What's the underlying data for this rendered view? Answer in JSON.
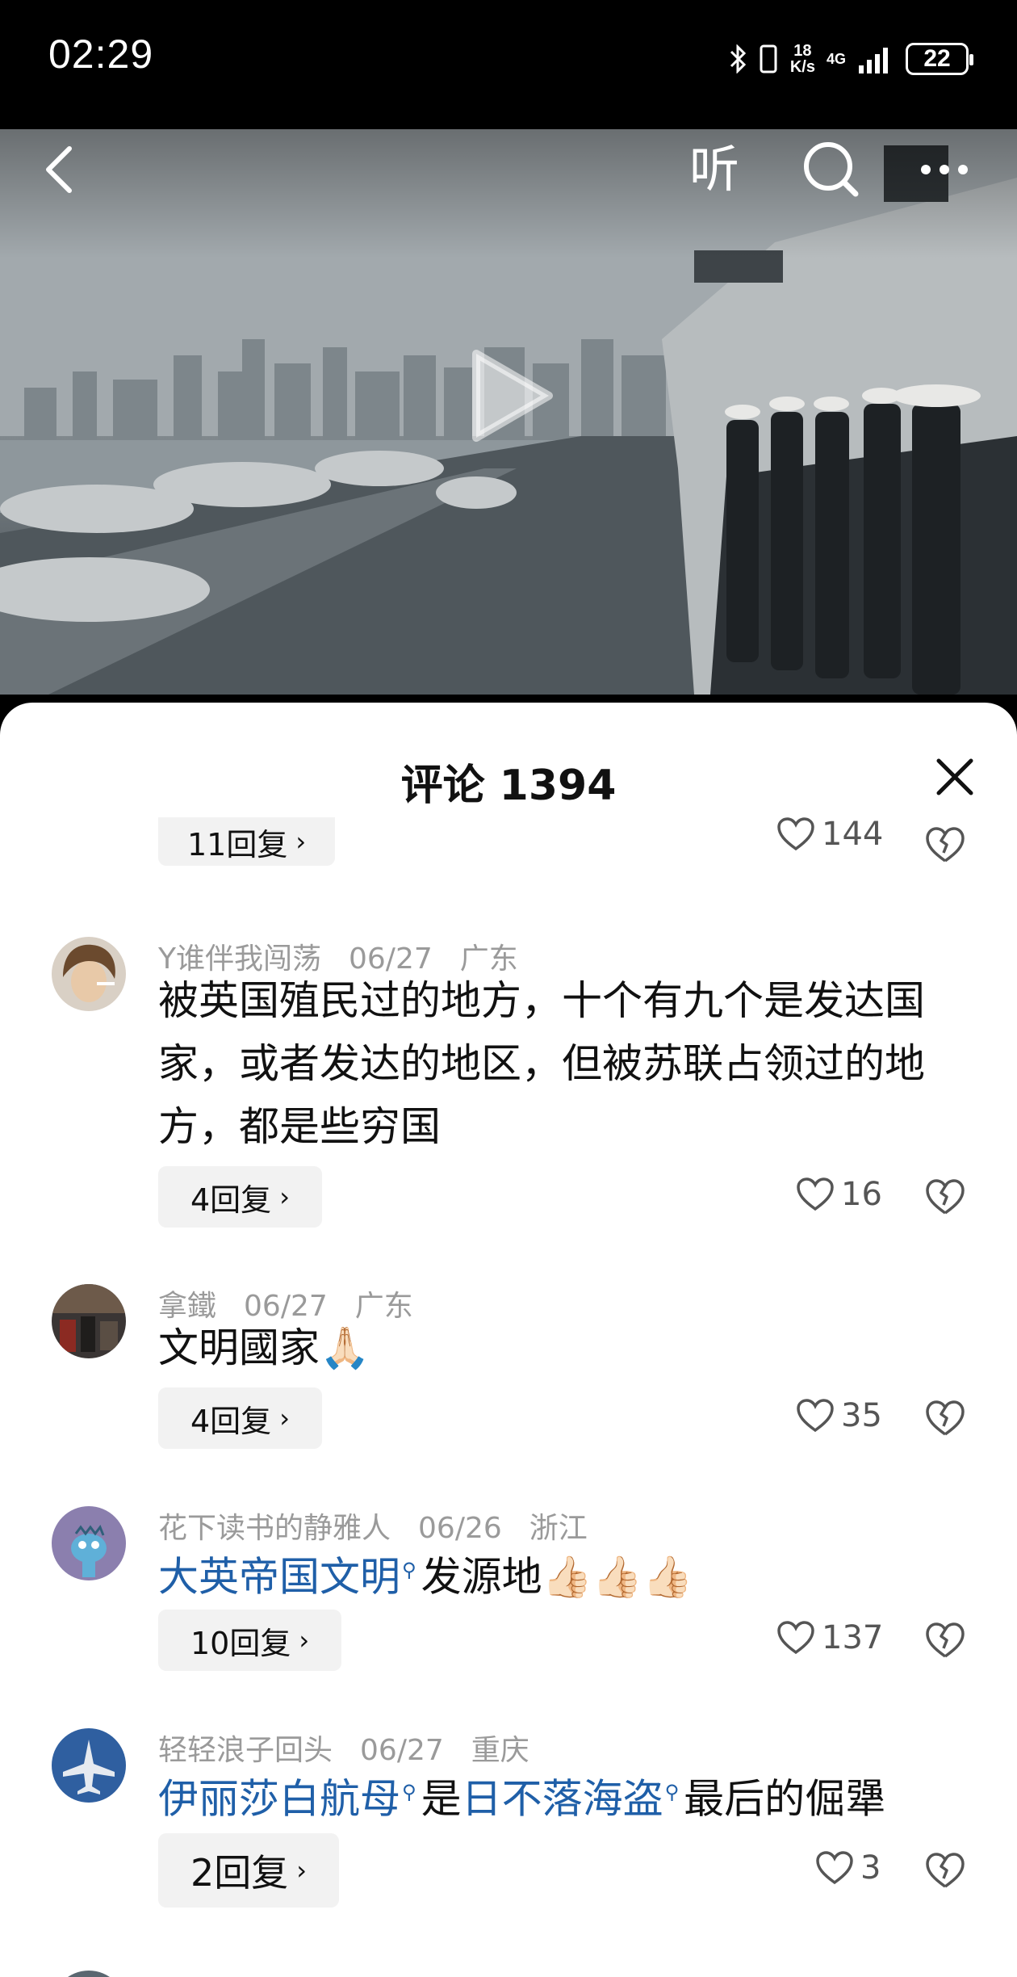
{
  "status_bar": {
    "time": "02:29",
    "net_speed_value": "18",
    "net_speed_unit": "K/s",
    "network": "4G",
    "battery": "22"
  },
  "video": {
    "listen_label": "听"
  },
  "comments_panel": {
    "title": "评论 1394",
    "partial_item": {
      "replies_label": "11回复",
      "likes": "144"
    },
    "items": [
      {
        "user": "Y谁伴我闯荡",
        "date": "06/27",
        "region": "广东",
        "text": "被英国殖民过的地方，十个有九个是发达国家，或者发达的地区，但被苏联占领过的地方，都是些穷国",
        "replies_label": "4回复",
        "likes": "16"
      },
      {
        "user": "拿鐵",
        "date": "06/27",
        "region": "广东",
        "text": "文明國家🙏🏻",
        "replies_label": "4回复",
        "likes": "35"
      },
      {
        "user": "花下读书的静雅人",
        "date": "06/26",
        "region": "浙江",
        "text_link": "大英帝国文明",
        "text_rest": "发源地👍🏻👍🏻👍🏻",
        "replies_label": "10回复",
        "likes": "137"
      },
      {
        "user": "轻轻浪子回头",
        "date": "06/27",
        "region": "重庆",
        "text_link1": "伊丽莎白航母",
        "text_mid": "是",
        "text_link2": "日不落海盗",
        "text_rest": "最后的倔犟",
        "replies_label": "2回复",
        "likes": "3"
      }
    ]
  }
}
